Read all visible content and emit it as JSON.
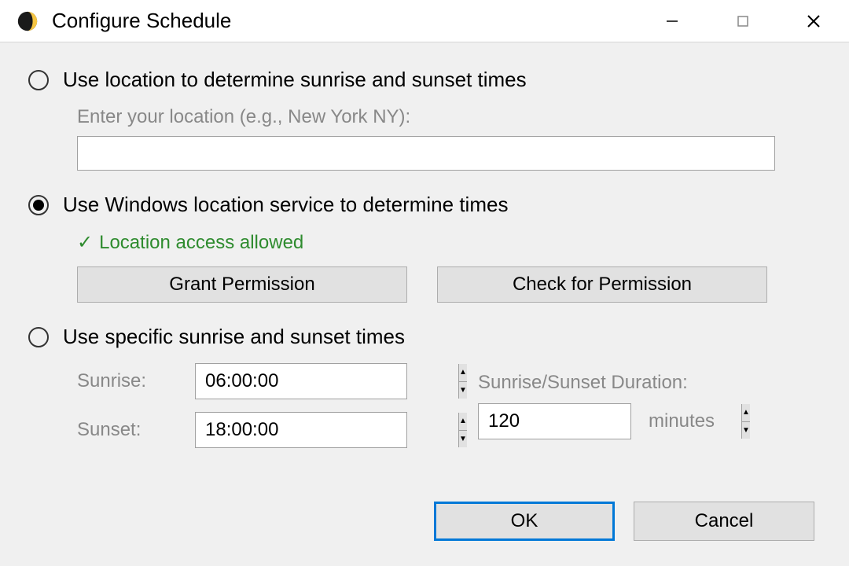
{
  "window": {
    "title": "Configure Schedule"
  },
  "options": {
    "location": {
      "label": "Use location to determine sunrise and sunset times",
      "field_label": "Enter your location (e.g., New York NY):",
      "value": ""
    },
    "windows_service": {
      "label": "Use Windows location service to determine times",
      "status": "Location access allowed",
      "grant_button": "Grant Permission",
      "check_button": "Check for Permission"
    },
    "specific": {
      "label": "Use specific sunrise and sunset times",
      "sunrise_label": "Sunrise:",
      "sunrise_value": "06:00:00",
      "sunset_label": "Sunset:",
      "sunset_value": "18:00:00",
      "duration_label": "Sunrise/Sunset Duration:",
      "duration_value": "120",
      "duration_unit": "minutes"
    }
  },
  "footer": {
    "ok": "OK",
    "cancel": "Cancel"
  },
  "selected_option": "windows_service",
  "colors": {
    "accent": "#0078d7",
    "success": "#2e8b2e"
  }
}
